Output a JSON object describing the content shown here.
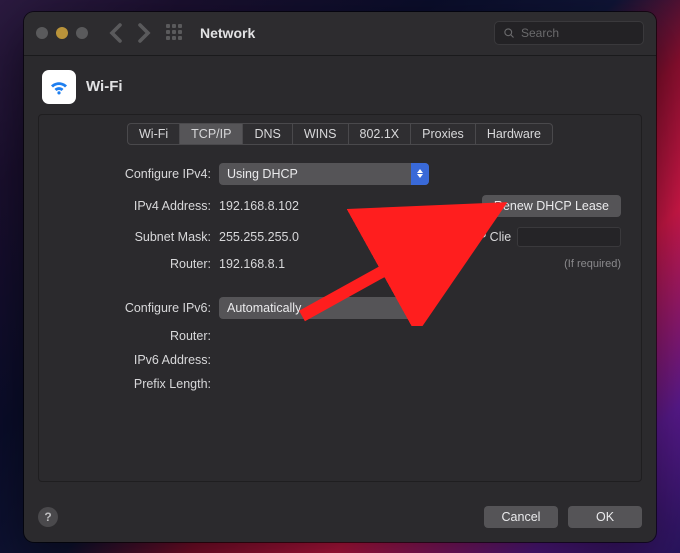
{
  "titlebar": {
    "title": "Network",
    "search_placeholder": "Search"
  },
  "header": {
    "title": "Wi-Fi"
  },
  "tabs": [
    {
      "label": "Wi-Fi",
      "active": false
    },
    {
      "label": "TCP/IP",
      "active": true
    },
    {
      "label": "DNS",
      "active": false
    },
    {
      "label": "WINS",
      "active": false
    },
    {
      "label": "802.1X",
      "active": false
    },
    {
      "label": "Proxies",
      "active": false
    },
    {
      "label": "Hardware",
      "active": false
    }
  ],
  "form": {
    "configure_ipv4_label": "Configure IPv4:",
    "configure_ipv4_value": "Using DHCP",
    "ipv4_address_label": "IPv4 Address:",
    "ipv4_address_value": "192.168.8.102",
    "subnet_mask_label": "Subnet Mask:",
    "subnet_mask_value": "255.255.255.0",
    "router_label": "Router:",
    "router_value": "192.168.8.1",
    "dhcp_client_id_label": "DHCP Client ID:",
    "dhcp_client_id_value": "",
    "if_required_label": "(If required)",
    "renew_lease_label": "Renew DHCP Lease",
    "configure_ipv6_label": "Configure IPv6:",
    "configure_ipv6_value": "Automatically",
    "router6_label": "Router:",
    "router6_value": "",
    "ipv6_address_label": "IPv6 Address:",
    "ipv6_address_value": "",
    "prefix_length_label": "Prefix Length:",
    "prefix_length_value": ""
  },
  "footer": {
    "help": "?",
    "cancel": "Cancel",
    "ok": "OK"
  }
}
